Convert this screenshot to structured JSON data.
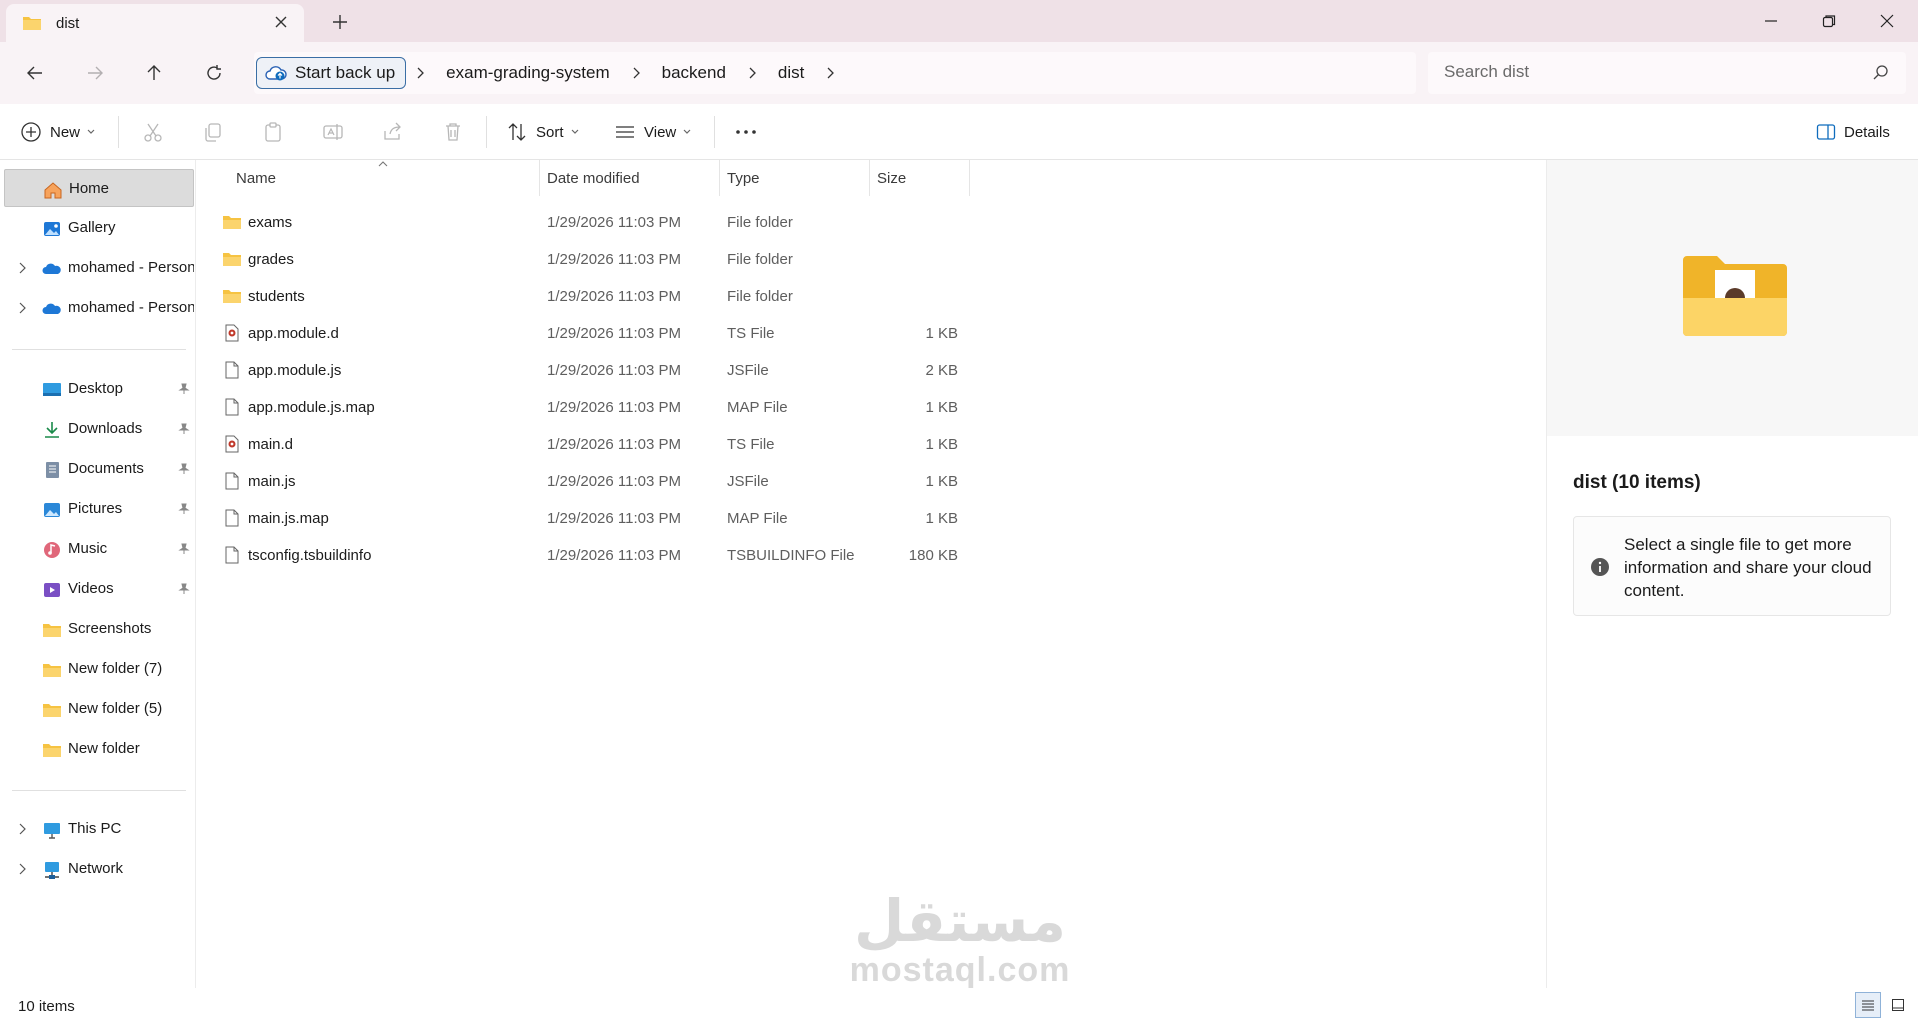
{
  "window": {
    "tab_title": "dist",
    "controls": {
      "minimize": "minimize-icon",
      "maximize": "restore-icon",
      "close": "close-icon"
    }
  },
  "addressbar": {
    "backup_label": "Start back up",
    "breadcrumbs": [
      "exam-grading-system",
      "backend",
      "dist"
    ]
  },
  "search": {
    "placeholder": "Search dist"
  },
  "toolbar": {
    "new_label": "New",
    "sort_label": "Sort",
    "view_label": "View",
    "details_label": "Details"
  },
  "sidebar": {
    "top": [
      {
        "label": "Home",
        "icon": "home-icon",
        "selected": true
      },
      {
        "label": "Gallery",
        "icon": "gallery-icon"
      },
      {
        "label": "mohamed - Personal",
        "icon": "onedrive-icon",
        "expandable": true
      },
      {
        "label": "mohamed - Personal",
        "icon": "onedrive-icon",
        "expandable": true
      }
    ],
    "quick_access": [
      {
        "label": "Desktop",
        "icon": "desktop-icon",
        "pinned": true
      },
      {
        "label": "Downloads",
        "icon": "downloads-icon",
        "pinned": true
      },
      {
        "label": "Documents",
        "icon": "documents-icon",
        "pinned": true
      },
      {
        "label": "Pictures",
        "icon": "pictures-icon",
        "pinned": true
      },
      {
        "label": "Music",
        "icon": "music-icon",
        "pinned": true
      },
      {
        "label": "Videos",
        "icon": "videos-icon",
        "pinned": true
      },
      {
        "label": "Screenshots",
        "icon": "folder-icon"
      },
      {
        "label": "New folder (7)",
        "icon": "folder-icon"
      },
      {
        "label": "New folder (5)",
        "icon": "folder-icon"
      },
      {
        "label": "New folder",
        "icon": "folder-icon"
      }
    ],
    "bottom": [
      {
        "label": "This PC",
        "icon": "pc-icon",
        "expandable": true
      },
      {
        "label": "Network",
        "icon": "network-icon",
        "expandable": true
      }
    ]
  },
  "columns": {
    "name": "Name",
    "date": "Date modified",
    "type": "Type",
    "size": "Size"
  },
  "files": [
    {
      "name": "exams",
      "date": "1/29/2026 11:03 PM",
      "type": "File folder",
      "size": "",
      "icon": "folder-icon"
    },
    {
      "name": "grades",
      "date": "1/29/2026 11:03 PM",
      "type": "File folder",
      "size": "",
      "icon": "folder-icon"
    },
    {
      "name": "students",
      "date": "1/29/2026 11:03 PM",
      "type": "File folder",
      "size": "",
      "icon": "folder-icon"
    },
    {
      "name": "app.module.d",
      "date": "1/29/2026 11:03 PM",
      "type": "TS File",
      "size": "1 KB",
      "icon": "ts-file-icon"
    },
    {
      "name": "app.module.js",
      "date": "1/29/2026 11:03 PM",
      "type": "JSFile",
      "size": "2 KB",
      "icon": "file-icon"
    },
    {
      "name": "app.module.js.map",
      "date": "1/29/2026 11:03 PM",
      "type": "MAP File",
      "size": "1 KB",
      "icon": "file-icon"
    },
    {
      "name": "main.d",
      "date": "1/29/2026 11:03 PM",
      "type": "TS File",
      "size": "1 KB",
      "icon": "ts-file-icon"
    },
    {
      "name": "main.js",
      "date": "1/29/2026 11:03 PM",
      "type": "JSFile",
      "size": "1 KB",
      "icon": "file-icon"
    },
    {
      "name": "main.js.map",
      "date": "1/29/2026 11:03 PM",
      "type": "MAP File",
      "size": "1 KB",
      "icon": "file-icon"
    },
    {
      "name": "tsconfig.tsbuildinfo",
      "date": "1/29/2026 11:03 PM",
      "type": "TSBUILDINFO File",
      "size": "180 KB",
      "icon": "file-icon"
    }
  ],
  "details": {
    "title": "dist (10 items)",
    "info": "Select a single file to get more information and share your cloud content."
  },
  "status": {
    "count": "10 items"
  },
  "watermark": {
    "arabic": "مستقل",
    "latin": "mostaql.com"
  },
  "colors": {
    "titlebar": "#efe1e7",
    "addressrow": "#f9f3f6",
    "folder": "#f6c342",
    "accent": "#0f6cbd"
  }
}
